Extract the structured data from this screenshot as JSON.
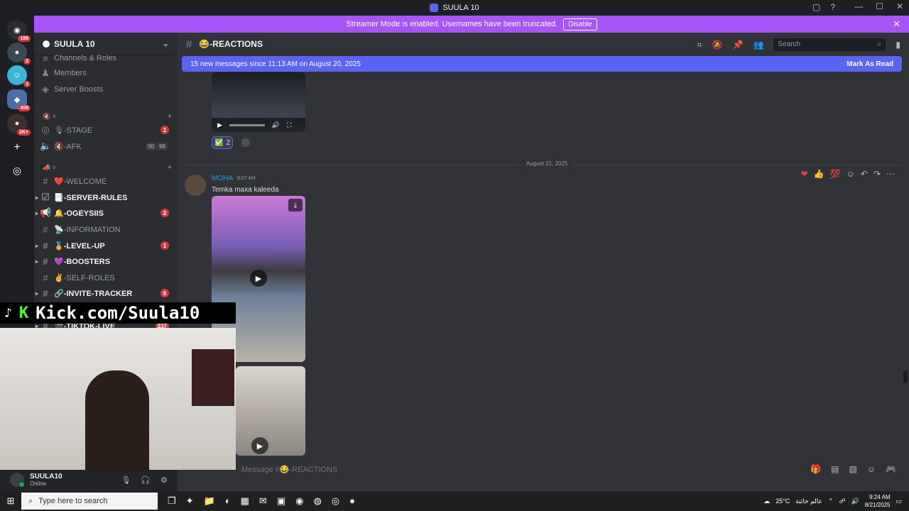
{
  "window": {
    "title": "SUULA 10",
    "controls": [
      "—",
      "☐",
      "✕"
    ],
    "tray_icons": [
      "▢",
      "?"
    ]
  },
  "banner": {
    "text": "Streamer Mode is enabled. Usernames have been truncated.",
    "button": "Disable",
    "close": "✕"
  },
  "servers": [
    {
      "name": "home",
      "glyph": "◉",
      "badge": "188"
    },
    {
      "name": "server-1",
      "glyph": "●",
      "badge": "2"
    },
    {
      "name": "server-2",
      "glyph": "☺",
      "badge": "1"
    },
    {
      "name": "server-3",
      "glyph": "◆",
      "badge": "458"
    },
    {
      "name": "server-4",
      "glyph": "●",
      "badge": "2K+"
    },
    {
      "name": "add-server",
      "glyph": "+",
      "badge": ""
    },
    {
      "name": "discover",
      "glyph": "◎",
      "badge": ""
    }
  ],
  "guild": {
    "name": "SUULA 10",
    "top_items": [
      "Channels & Roles",
      "Members",
      "Server Boosts"
    ]
  },
  "channels": {
    "voice_category": "🔇 ˅",
    "voice": [
      {
        "name": "🎙-STAGE",
        "count": "1"
      },
      {
        "name": "🔇-AFK",
        "extra1": "00",
        "extra2": "99"
      }
    ],
    "text_category": "📣 ˅",
    "text": [
      {
        "name": "❤️-WELCOME",
        "unread": false,
        "count": ""
      },
      {
        "name": "📑-SERVER-RULES",
        "unread": true,
        "count": ""
      },
      {
        "name": "🔔-OGEYSIIS",
        "unread": true,
        "count": "2"
      },
      {
        "name": "📡-INFORMATION",
        "unread": false,
        "count": ""
      },
      {
        "name": "🏅-LEVEL-UP",
        "unread": true,
        "count": "1"
      },
      {
        "name": "💜-BOOSTERS",
        "unread": true,
        "count": ""
      },
      {
        "name": "✌️-SELF-ROLES",
        "unread": false,
        "count": ""
      },
      {
        "name": "🔗-INVITE-TRACKER",
        "unread": true,
        "count": "6"
      },
      {
        "name": "🎬-TIKTOK-LIVE",
        "unread": true,
        "count": "237"
      }
    ]
  },
  "user": {
    "name": "SUULA10",
    "status": "Online"
  },
  "header": {
    "channel": "😂-REACTIONS",
    "search_placeholder": "Search"
  },
  "new_messages": {
    "text": "15 new messages since 11:13 AM on August 20, 2025",
    "action": "Mark As Read"
  },
  "reaction": {
    "emoji": "✅",
    "count": "2"
  },
  "divider_date": "August 21, 2025",
  "message": {
    "author": "MOHA",
    "time": "8:07 AM",
    "text": "Temka maxa kaleeda",
    "hover_actions": [
      "❤",
      "👍",
      "💯",
      "☺",
      "↶",
      "↷",
      "⋯"
    ]
  },
  "composer": {
    "placeholder": "Message #😂-REACTIONS"
  },
  "overlay": {
    "text": "Kick.com/Suula10"
  },
  "taskbar": {
    "search_placeholder": "Type here to search",
    "weather": "25°C",
    "lang": "عالم خائنة",
    "time": "9:24 AM",
    "date": "8/21/2025"
  },
  "colors": {
    "accent": "#5865f2",
    "banner": "#a855f7",
    "badge": "#da373c",
    "author": "#00a8fc"
  }
}
